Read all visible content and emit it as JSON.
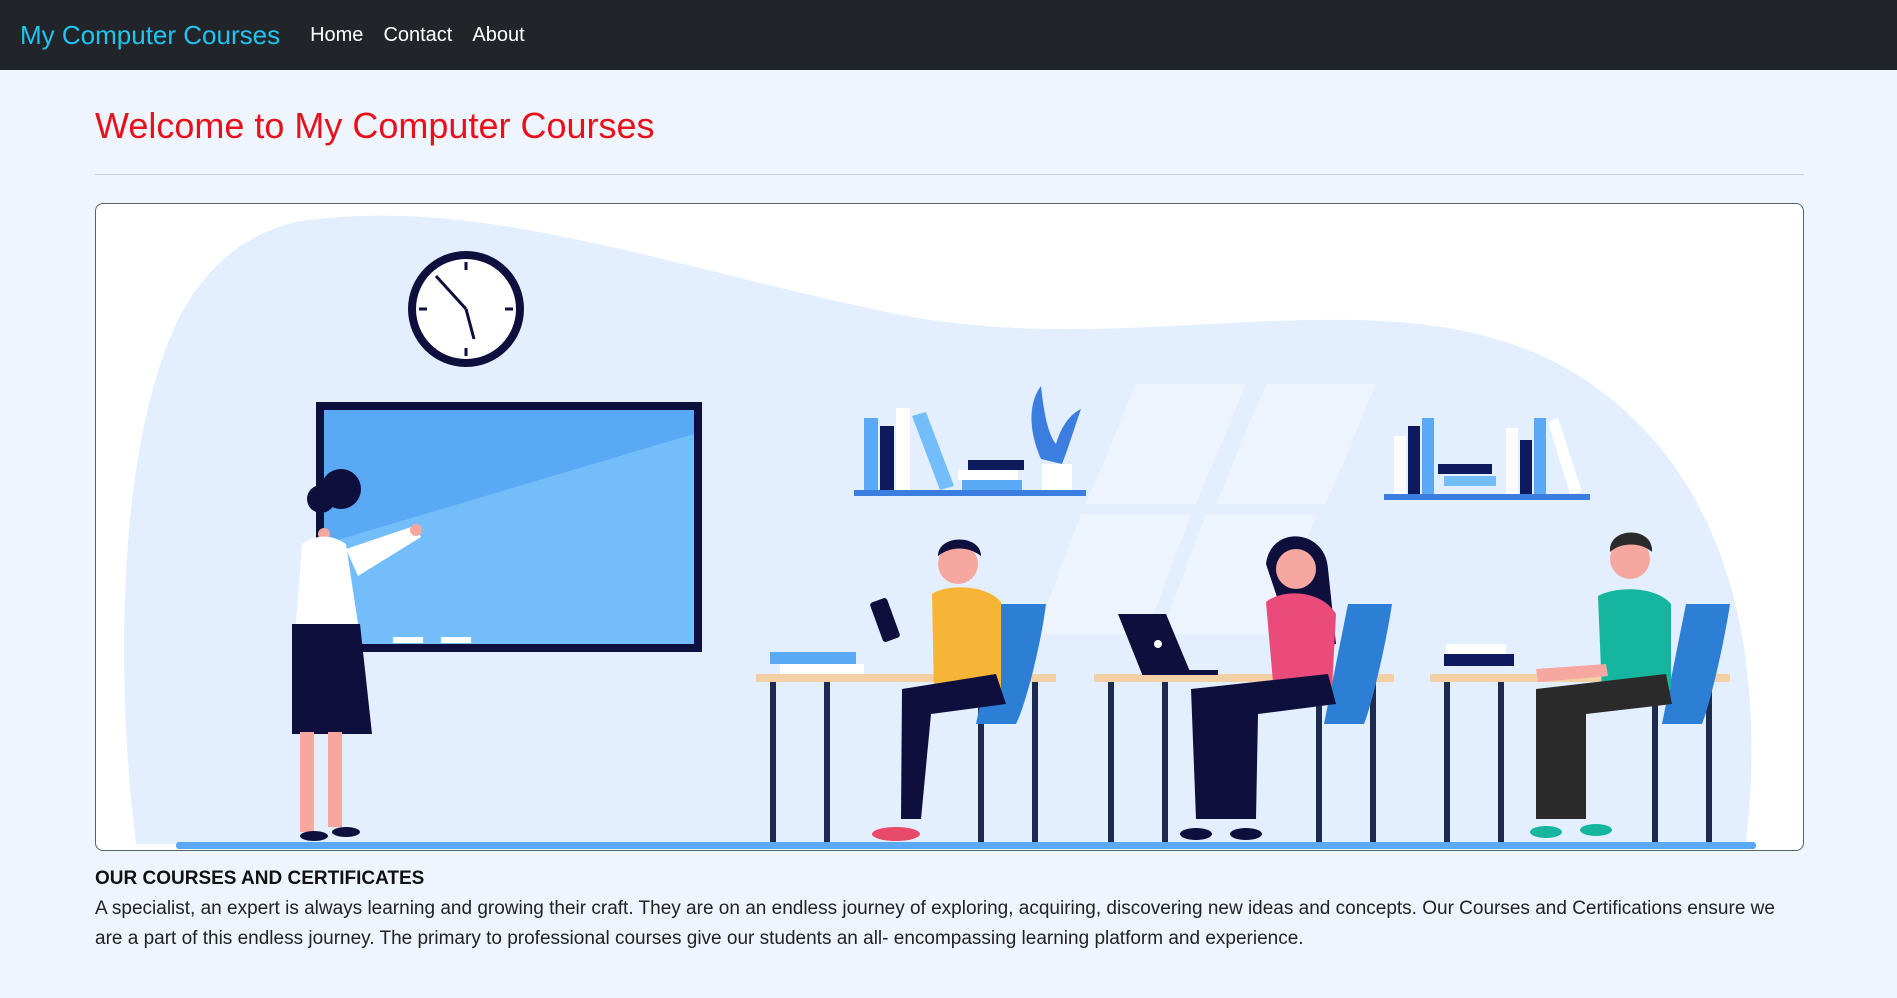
{
  "navbar": {
    "brand": "My Computer Courses",
    "links": [
      "Home",
      "Contact",
      "About"
    ]
  },
  "page": {
    "title": "Welcome to My Computer Courses"
  },
  "section": {
    "title": "OUR COURSES AND CERTIFICATES",
    "text": "A specialist, an expert is always learning and growing their craft. They are on an endless journey of exploring, acquiring, discovering new ideas and concepts. Our Courses and Certifications ensure we are a part of this endless journey. The primary to professional courses give our students an all- encompassing learning platform and experience."
  },
  "colors": {
    "navbar_bg": "#212529",
    "brand": "#21c4f0",
    "title": "#e8101a",
    "page_bg": "#eef5fe"
  }
}
